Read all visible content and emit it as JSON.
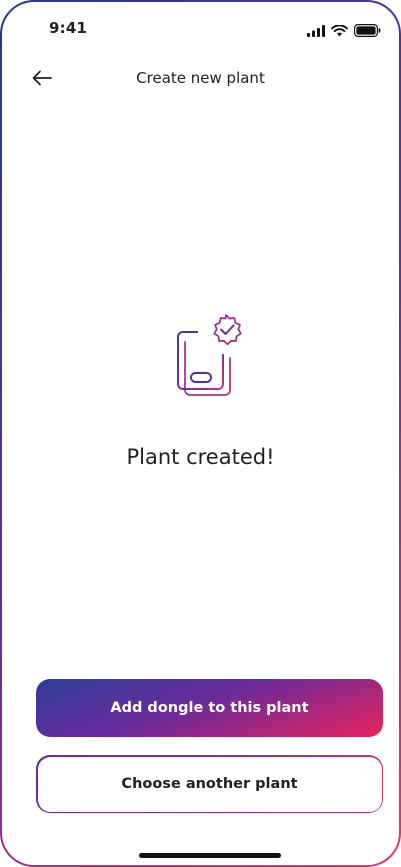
{
  "status_bar": {
    "time": "9:41",
    "icons": [
      "signal-icon",
      "wifi-icon",
      "battery-icon"
    ]
  },
  "header": {
    "back_icon": "arrow-left-icon",
    "title": "Create new plant"
  },
  "main": {
    "illustration_icon": "device-verified-icon",
    "message": "Plant created!"
  },
  "actions": {
    "primary_label": "Add dongle to this plant",
    "secondary_label": "Choose another plant"
  },
  "colors": {
    "gradient_start": "#2d3f98",
    "gradient_mid": "#6a2a9a",
    "gradient_end": "#e8245c",
    "text": "#1f1f24"
  }
}
